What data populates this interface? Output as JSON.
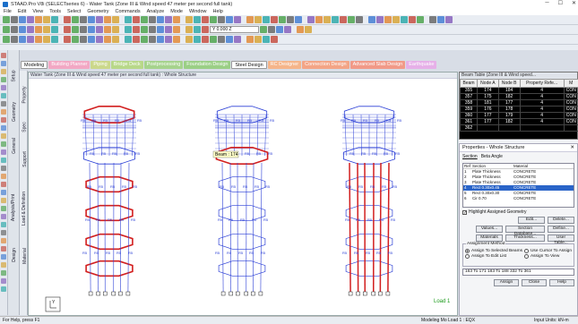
{
  "window": {
    "title": "STAAD.Pro V8i (SELECTseries 6) - Water Tank (Zone III & Wind speed 47 meter per second full tank)"
  },
  "menu": [
    "File",
    "Edit",
    "View",
    "Tools",
    "Select",
    "Geometry",
    "Commands",
    "Analyze",
    "Mode",
    "Window",
    "Help"
  ],
  "toolbar": {
    "select_value": "Y 0.000 Z"
  },
  "side_tabs": [
    "Setup",
    "Geometry",
    "General",
    "Analysis/Print",
    "Design"
  ],
  "side_tabs2": [
    "Property",
    "Spec",
    "Support",
    "Load & Definition",
    "Material"
  ],
  "modes": {
    "tabs": [
      {
        "label": "Modeling",
        "color": "#ffffff",
        "active": true
      },
      {
        "label": "Building Planner",
        "color": "#f2a8c4"
      },
      {
        "label": "Piping",
        "color": "#cbd88b"
      },
      {
        "label": "Bridge Deck",
        "color": "#b8d889"
      },
      {
        "label": "Postprocessing",
        "color": "#a6d38d"
      },
      {
        "label": "Foundation Design",
        "color": "#9bcf86"
      },
      {
        "label": "Steel Design",
        "color": "#ffffff",
        "active": true
      },
      {
        "label": "RC Designer",
        "color": "#f5b58a"
      },
      {
        "label": "Connection Design",
        "color": "#f3a586"
      },
      {
        "label": "Advanced Slab Design",
        "color": "#f19a88"
      },
      {
        "label": "Earthquake",
        "color": "#e6b0e8"
      }
    ]
  },
  "viewport": {
    "title": "Water Tank (Zone III & Wind speed 47 meter per second full tank) : Whole Structure",
    "beam_tip": "Beam : 174",
    "load_label": "Load 1",
    "axis_label": "Y",
    "r_label": "R5"
  },
  "beam_table": {
    "title": "Beam Table (Zone III & Wind speed...",
    "columns": [
      "Beam",
      "Node A",
      "Node B",
      "Property Refe...",
      "M"
    ],
    "rows": [
      [
        "355",
        "174",
        "184",
        "4",
        "CON"
      ],
      [
        "357",
        "175",
        "182",
        "4",
        "CON"
      ],
      [
        "358",
        "181",
        "177",
        "4",
        "CON"
      ],
      [
        "359",
        "176",
        "178",
        "4",
        "CON"
      ],
      [
        "360",
        "177",
        "179",
        "4",
        "CON"
      ],
      [
        "361",
        "177",
        "182",
        "4",
        "CON"
      ],
      [
        "362",
        "",
        "",
        "",
        ""
      ]
    ]
  },
  "properties": {
    "title": "Properties - Whole Structure",
    "tabs": [
      "Section",
      "Beta Angle"
    ],
    "list_headers": [
      "Ref",
      "Section",
      "Material"
    ],
    "rows": [
      {
        "ref": "1",
        "section": "Plate Thickness",
        "material": "CONCRETE",
        "selected": false
      },
      {
        "ref": "2",
        "section": "Plate Thickness",
        "material": "CONCRETE",
        "selected": false
      },
      {
        "ref": "3",
        "section": "Plate Thickness",
        "material": "CONCRETE",
        "selected": false
      },
      {
        "ref": "4",
        "section": "Rect 0.30x0.45",
        "material": "CONCRETE",
        "selected": true
      },
      {
        "ref": "5",
        "section": "Rect 0.30x0.30",
        "material": "CONCRETE",
        "selected": false
      },
      {
        "ref": "6",
        "section": "Cir 0.70",
        "material": "CONCRETE",
        "selected": false
      }
    ],
    "highlight": "Highlight Assigned Geometry",
    "btn_edit": "Edit...",
    "btn_delete": "Delete...",
    "btn_values": "Values...",
    "btn_section_db": "Section Database...",
    "btn_define": "Define...",
    "btn_materials": "Materials",
    "btn_thickness": "Thickness...",
    "btn_user_table": "User Table...",
    "assignment_method": "Assignment Method",
    "opt1": "Assign To Selected Beams",
    "opt2": "Use Cursor To Assign",
    "opt3": "Assign To Edit List",
    "opt4": "Assign To View",
    "assign_list": "163 To 171 183 To 188 332 To 361",
    "btn_assign": "Assign",
    "btn_close": "Close",
    "btn_help": "Help"
  },
  "status": {
    "left": "For Help, press F1",
    "mid": "Modeling Mo Load 1 : EQX",
    "right": "Input Units: kN-m"
  }
}
